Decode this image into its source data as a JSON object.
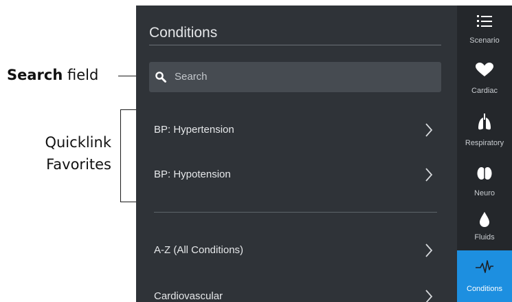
{
  "annotations": {
    "search_label_bold": "Search",
    "search_label_rest": " field",
    "quicklink_line1": "Quicklink",
    "quicklink_line2": "Favorites"
  },
  "panel": {
    "title": "Conditions",
    "search": {
      "placeholder": "Search",
      "icon": "search-icon"
    },
    "favorites": [
      {
        "label": "BP: Hypertension"
      },
      {
        "label": "BP: Hypotension"
      }
    ],
    "categories": [
      {
        "label": "A-Z (All Conditions)"
      },
      {
        "label": "Cardiovascular"
      }
    ]
  },
  "nav": {
    "items": [
      {
        "label": "Scenario",
        "icon": "list-icon"
      },
      {
        "label": "Cardiac",
        "icon": "heart-icon"
      },
      {
        "label": "Respiratory",
        "icon": "lungs-icon"
      },
      {
        "label": "Neuro",
        "icon": "brain-icon"
      },
      {
        "label": "Fluids",
        "icon": "droplet-icon"
      },
      {
        "label": "Conditions",
        "icon": "pulse-icon",
        "active": true
      }
    ]
  },
  "colors": {
    "panel_bg": "#2f3338",
    "rail_bg": "#24272b",
    "search_bg": "#464b51",
    "accent": "#1d8fe0"
  }
}
